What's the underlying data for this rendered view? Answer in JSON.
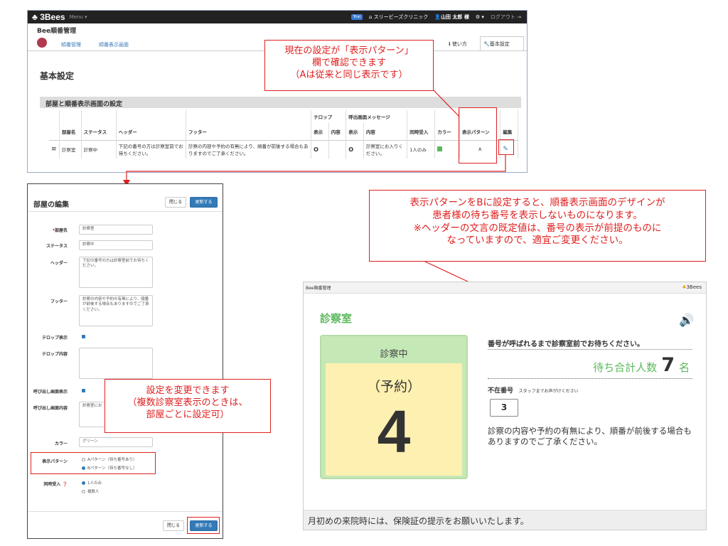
{
  "top_panel": {
    "nav": {
      "brand": "3Bees",
      "menu": "Menu",
      "trial": "Trial",
      "clinic": "スリービーズクリニック",
      "user": "山田 太郎 様",
      "logout": "ログアウト"
    },
    "app_title": "Bee順番管理",
    "subnav": {
      "item1": "順番管理",
      "item2": "順番表示画面",
      "help": "使い方",
      "settings": "基本設定"
    },
    "page_heading": "基本設定",
    "section_title": "部屋と順番表示画面の設定",
    "table": {
      "group_telop": "テロップ",
      "group_call": "呼出画面メッセージ",
      "headers": [
        "部屋名",
        "ステータス",
        "ヘッダー",
        "フッター",
        "表示",
        "内容",
        "表示",
        "内容",
        "同時受入",
        "カラー",
        "表示パターン",
        "編集"
      ],
      "row": {
        "room": "診察室",
        "status": "診察中",
        "header": "下記の番号の方は診察室前でお待ちください。",
        "footer": "診察の内容や予約の有無により、順番が前後する場合もありますのでご了承ください。",
        "telop_show": "O",
        "call_show": "O",
        "call_content": "診察室にお入りください。",
        "simul": "1人のみ",
        "pattern": "A"
      }
    }
  },
  "callout_top": {
    "line1": "現在の設定が「表示パターン」",
    "line2": "欄で確認できます",
    "line3": "（Aは従来と同じ表示です）"
  },
  "edit_dialog": {
    "title": "部屋の編集",
    "close": "閉じる",
    "update": "更新する",
    "fields": {
      "room_label": "部屋名",
      "room_value": "診察室",
      "required_mark": "*",
      "status_label": "ステータス",
      "status_value": "診察中",
      "header_label": "ヘッダー",
      "header_value": "下記の番号の方は診察室前でお待ちください。",
      "footer_label": "フッター",
      "footer_value": "診察の内容や予約の有無により、順番が前後する場合もありますのでご了承ください。",
      "telop_show_label": "テロップ表示",
      "telop_content_label": "テロップ内容",
      "call_show_label": "呼び出し画面表示",
      "call_content_label": "呼び出し画面内容",
      "call_content_value": "診察室にお",
      "color_label": "カラー",
      "color_value": "グリーン",
      "pattern_label": "表示パターン",
      "pattern_a": "Aパターン（待ち番号あり）",
      "pattern_b": "Bパターン（待ち番号なし）",
      "simul_label": "同時受入",
      "simul_one": "1人のみ",
      "simul_many": "複数人"
    }
  },
  "callout_middle": {
    "line1": "設定を変更できます",
    "line2": "（複数診察室表示のときは、",
    "line3": "部屋ごとに設定可）"
  },
  "callout_right": {
    "line1": "表示パターンをBに設定すると、順番表示画面のデザインが",
    "line2": "患者様の待ち番号を表示しないものになります。",
    "line3": "※ヘッダーの文言の既定値は、番号の表示が前提のものに",
    "line4": "なっていますので、適宜ご変更ください。"
  },
  "display_screen": {
    "app_title": "Bee順番管理",
    "brand": "3Bees",
    "room": "診察室",
    "status": "診察中",
    "number_type": "（予約）",
    "number": "4",
    "header_msg": "番号が呼ばれるまで診察室前でお待ちください。",
    "wait_label": "待ち合計人数",
    "wait_count": "7",
    "wait_unit": "名",
    "absent_label": "不在番号",
    "absent_hint": "スタッフまでお声がけください",
    "absent_number": "3",
    "footer_msg": "診察の内容や予約の有無により、順番が前後する場合もありますのでご了承ください。",
    "ticker": "月初めの来院時には、保険証の提示をお願いいたします。"
  },
  "colors": {
    "accent": "#337ab7",
    "callout": "#e02020",
    "green": "#5cb85c",
    "display_status_bg": "#c5e8b7",
    "display_number_bg": "#fdf0b0"
  }
}
